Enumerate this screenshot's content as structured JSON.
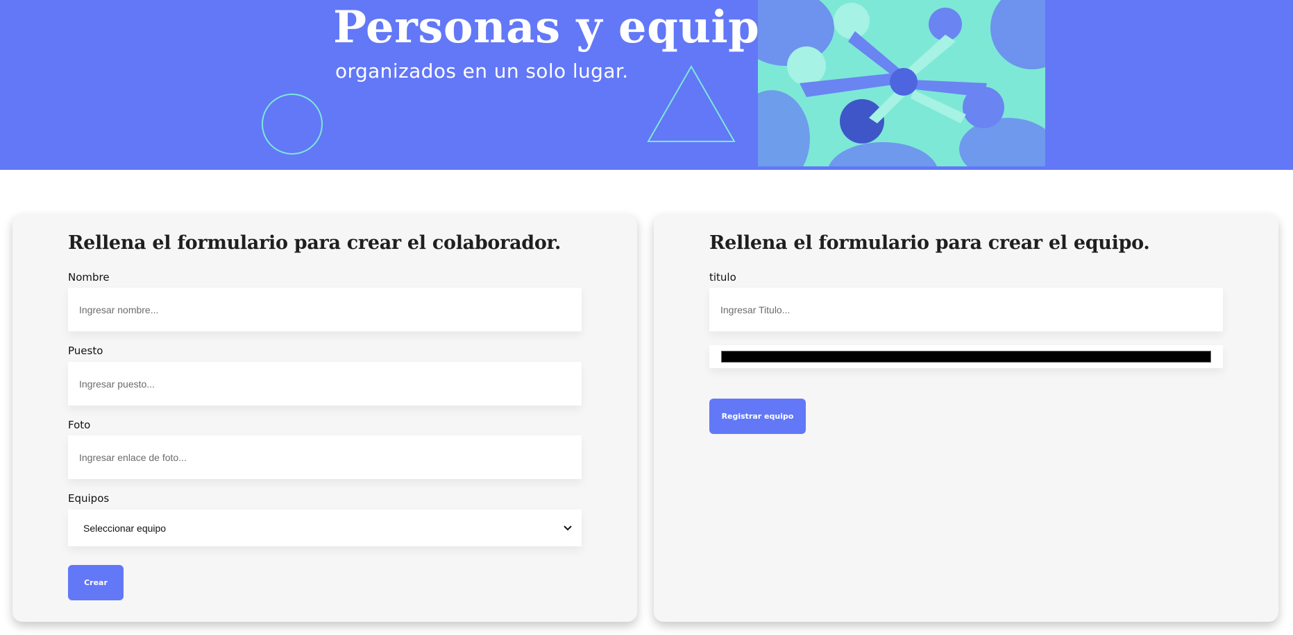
{
  "banner": {
    "title": "Personas y equipos",
    "subtitle": "organizados en un solo lugar.",
    "background_color": "#6278f7",
    "accent_color": "#7de8d6",
    "hero_image": "team-hands-together-photo"
  },
  "collaborator_form": {
    "heading": "Rellena el formulario para crear el colaborador.",
    "fields": {
      "name": {
        "label": "Nombre",
        "placeholder": "Ingresar nombre...",
        "value": ""
      },
      "position": {
        "label": "Puesto",
        "placeholder": "Ingresar puesto...",
        "value": ""
      },
      "photo": {
        "label": "Foto",
        "placeholder": "Ingresar enlace de foto...",
        "value": ""
      },
      "team": {
        "label": "Equipos",
        "selected": "Seleccionar equipo"
      }
    },
    "submit_label": "Crear"
  },
  "team_form": {
    "heading": "Rellena el formulario para crear el equipo.",
    "fields": {
      "title": {
        "label": "titulo",
        "placeholder": "Ingresar Titulo...",
        "value": ""
      },
      "color": {
        "value": "#000000"
      }
    },
    "submit_label": "Registrar equipo"
  }
}
